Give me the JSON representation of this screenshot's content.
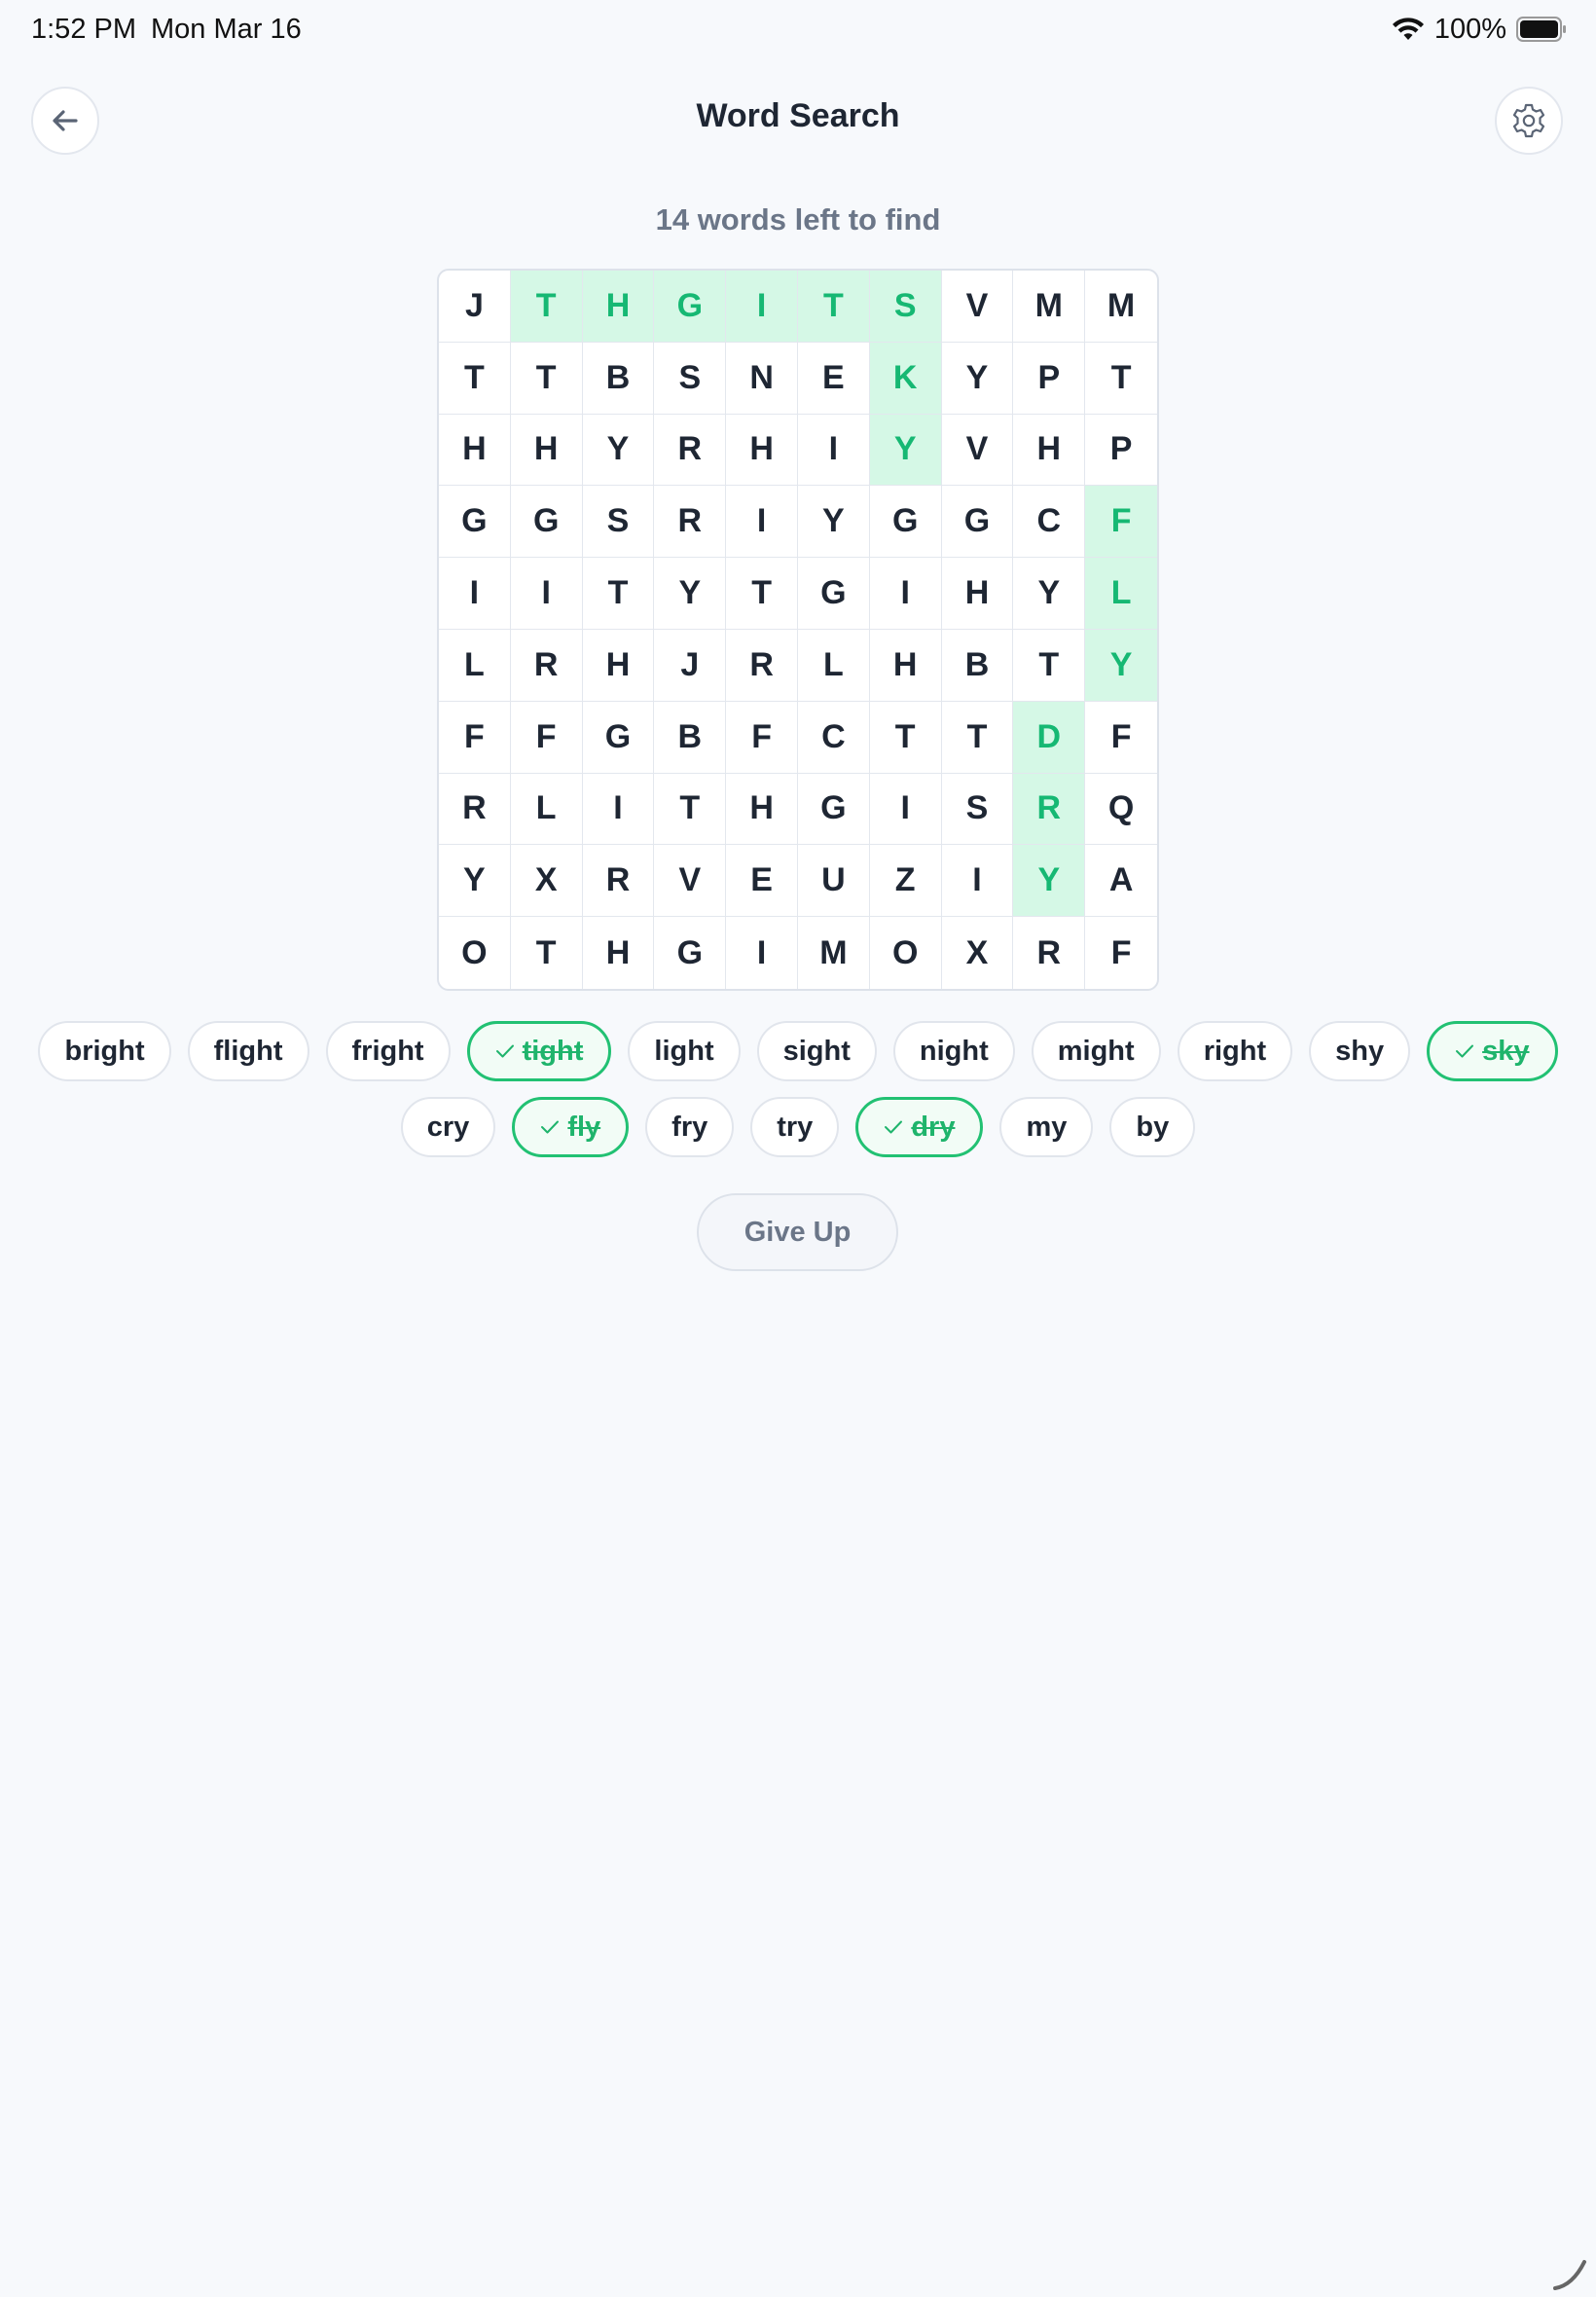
{
  "status_bar": {
    "time": "1:52 PM",
    "date": "Mon Mar 16",
    "battery": "100%"
  },
  "header": {
    "title": "Word Search",
    "back_icon": "arrow-left-icon",
    "settings_icon": "gear-icon"
  },
  "counter_text": "14 words left to find",
  "grid": {
    "rows": [
      [
        "J",
        "T",
        "H",
        "G",
        "I",
        "T",
        "S",
        "V",
        "M",
        "M"
      ],
      [
        "T",
        "T",
        "B",
        "S",
        "N",
        "E",
        "K",
        "Y",
        "P",
        "T"
      ],
      [
        "H",
        "H",
        "Y",
        "R",
        "H",
        "I",
        "Y",
        "V",
        "H",
        "P"
      ],
      [
        "G",
        "G",
        "S",
        "R",
        "I",
        "Y",
        "G",
        "G",
        "C",
        "F"
      ],
      [
        "I",
        "I",
        "T",
        "Y",
        "T",
        "G",
        "I",
        "H",
        "Y",
        "L"
      ],
      [
        "L",
        "R",
        "H",
        "J",
        "R",
        "L",
        "H",
        "B",
        "T",
        "Y"
      ],
      [
        "F",
        "F",
        "G",
        "B",
        "F",
        "C",
        "T",
        "T",
        "D",
        "F"
      ],
      [
        "R",
        "L",
        "I",
        "T",
        "H",
        "G",
        "I",
        "S",
        "R",
        "Q"
      ],
      [
        "Y",
        "X",
        "R",
        "V",
        "E",
        "U",
        "Z",
        "I",
        "Y",
        "A"
      ],
      [
        "O",
        "T",
        "H",
        "G",
        "I",
        "M",
        "O",
        "X",
        "R",
        "F"
      ]
    ],
    "found_cells": [
      [
        0,
        1
      ],
      [
        0,
        2
      ],
      [
        0,
        3
      ],
      [
        0,
        4
      ],
      [
        0,
        5
      ],
      [
        0,
        6
      ],
      [
        1,
        6
      ],
      [
        2,
        6
      ],
      [
        3,
        9
      ],
      [
        4,
        9
      ],
      [
        5,
        9
      ],
      [
        6,
        8
      ],
      [
        7,
        8
      ],
      [
        8,
        8
      ]
    ]
  },
  "words": {
    "row1": [
      {
        "label": "bright",
        "found": false
      },
      {
        "label": "flight",
        "found": false
      },
      {
        "label": "fright",
        "found": false
      },
      {
        "label": "tight",
        "found": true
      },
      {
        "label": "light",
        "found": false
      },
      {
        "label": "sight",
        "found": false
      },
      {
        "label": "night",
        "found": false
      },
      {
        "label": "might",
        "found": false
      },
      {
        "label": "right",
        "found": false
      },
      {
        "label": "shy",
        "found": false
      },
      {
        "label": "sky",
        "found": true
      }
    ],
    "row2": [
      {
        "label": "cry",
        "found": false
      },
      {
        "label": "fly",
        "found": true
      },
      {
        "label": "fry",
        "found": false
      },
      {
        "label": "try",
        "found": false
      },
      {
        "label": "dry",
        "found": true
      },
      {
        "label": "my",
        "found": false
      },
      {
        "label": "by",
        "found": false
      }
    ]
  },
  "give_up_label": "Give Up",
  "colors": {
    "found_bg": "#d5f8e6",
    "found_text": "#16b873",
    "chip_found_border": "#22c173"
  }
}
